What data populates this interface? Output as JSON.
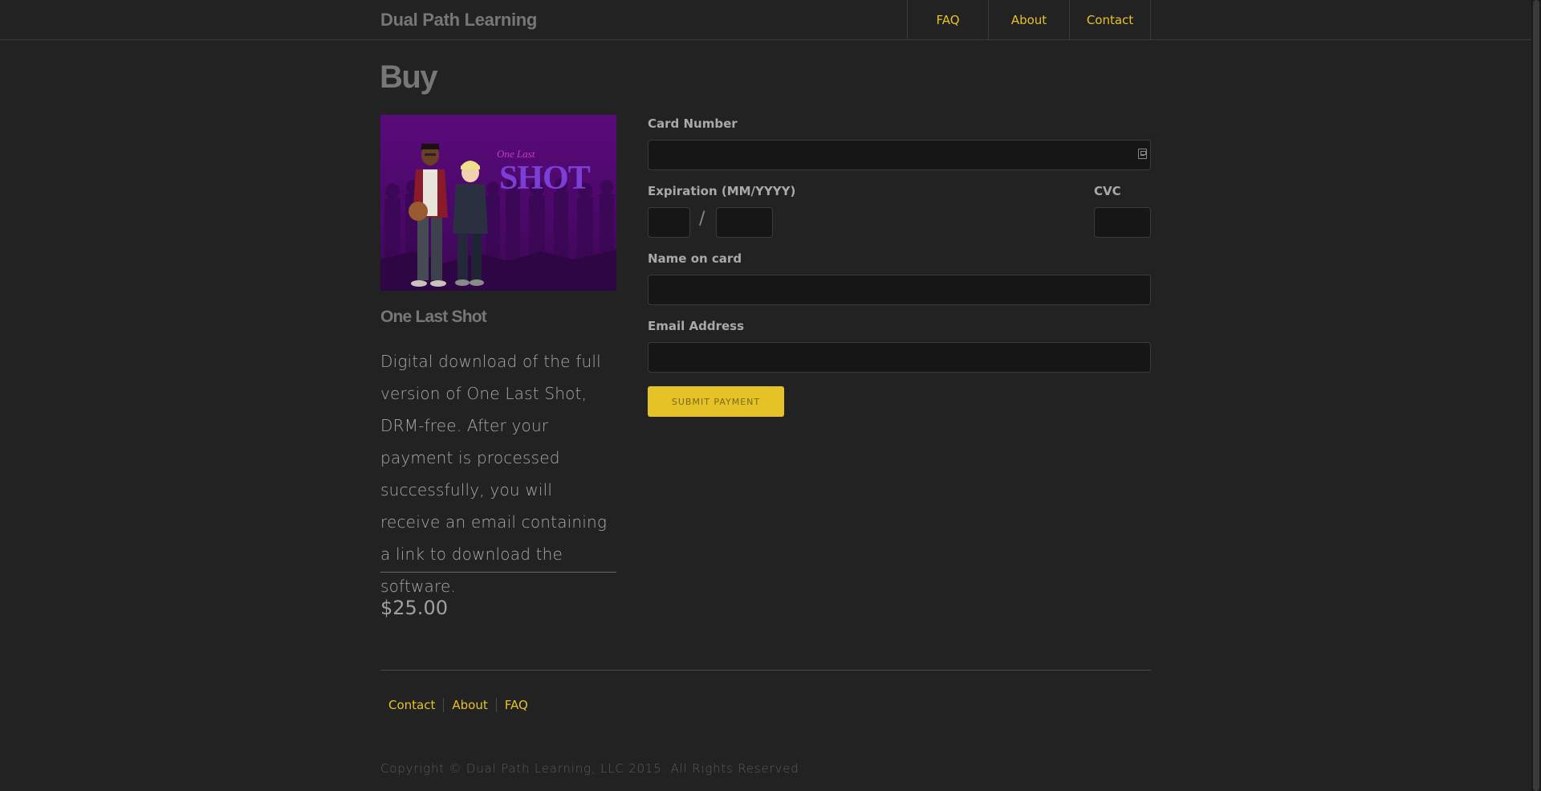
{
  "header": {
    "brand": "Dual Path Learning",
    "nav": [
      "FAQ",
      "About",
      "Contact"
    ]
  },
  "page": {
    "title": "Buy"
  },
  "product": {
    "image_title_small": "One Last",
    "image_title_big": "SHOT",
    "name": "One Last Shot",
    "description": "Digital download of the full version of One Last Shot, DRM-free. After your payment is processed successfully, you will receive an email containing a link to download the software.",
    "price": "$25.00"
  },
  "form": {
    "card_number_label": "Card Number",
    "card_number_value": "",
    "expiration_label": "Expiration (MM/YYYY)",
    "exp_month_value": "",
    "exp_year_value": "",
    "slash": "/",
    "cvc_label": "CVC",
    "cvc_value": "",
    "name_label": "Name on card",
    "name_value": "",
    "email_label": "Email Address",
    "email_value": "",
    "submit_label": "SUBMIT PAYMENT"
  },
  "footer": {
    "links": [
      "Contact",
      "About",
      "FAQ"
    ],
    "copyright": "Copyright © Dual Path Learning, LLC 2015. All Rights Reserved"
  },
  "colors": {
    "background": "#222222",
    "accent": "#e5c327",
    "muted": "#777777"
  }
}
